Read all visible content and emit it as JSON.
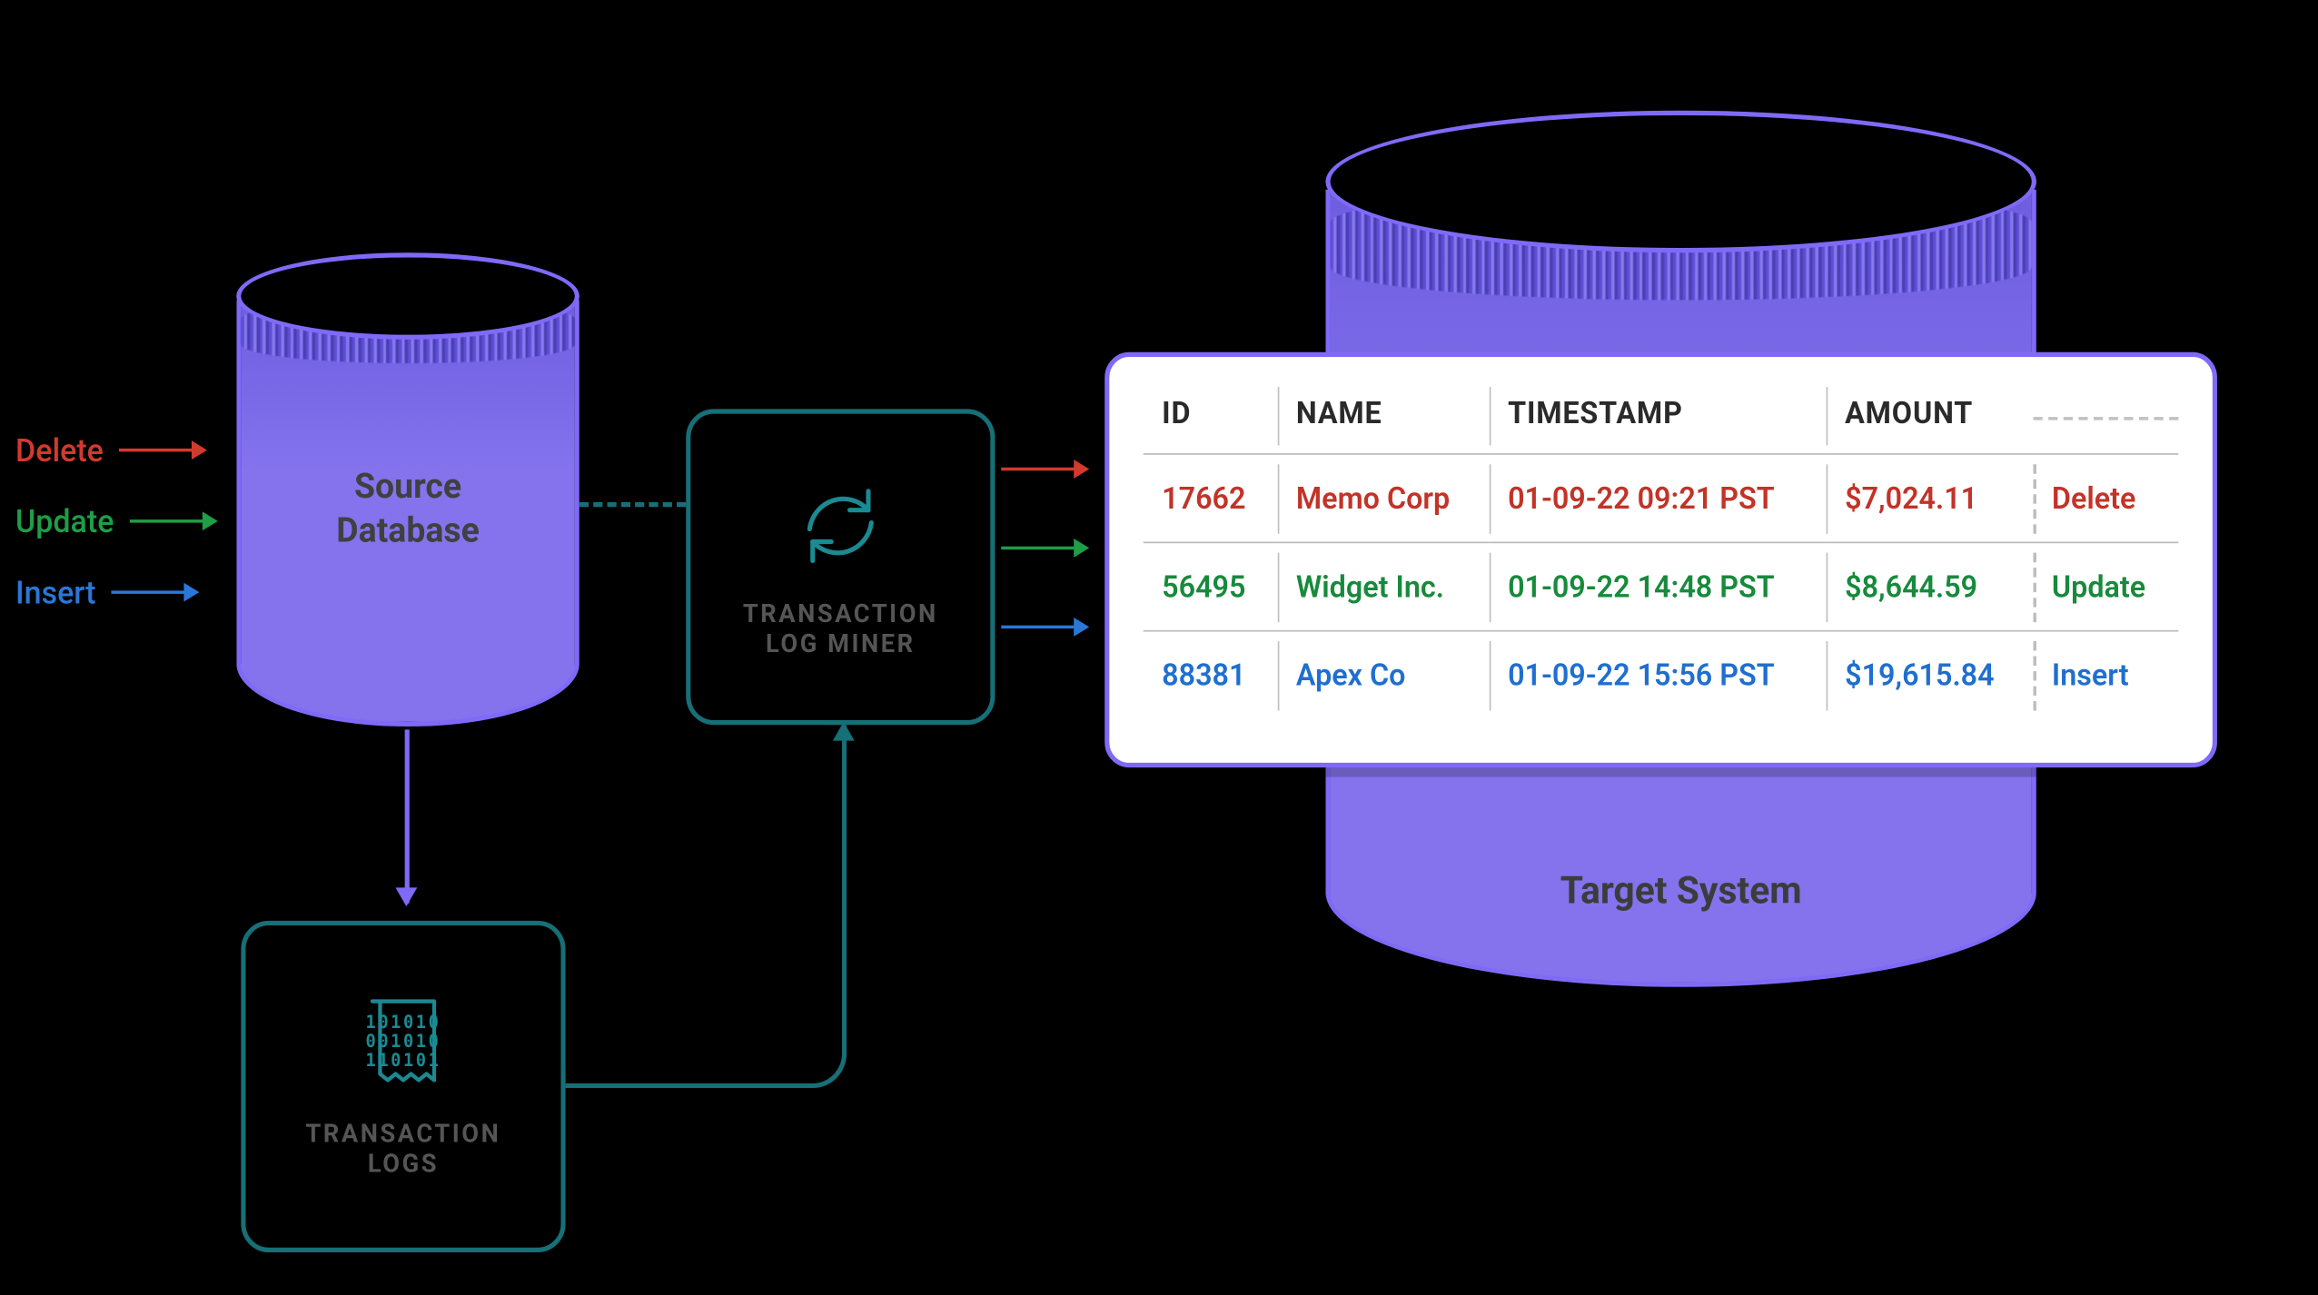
{
  "operations": {
    "delete_label": "Delete",
    "update_label": "Update",
    "insert_label": "Insert"
  },
  "source_db": {
    "label_line1": "Source",
    "label_line2": "Database"
  },
  "target_db": {
    "label": "Target System"
  },
  "miner": {
    "label_line1": "TRANSACTION",
    "label_line2": "LOG MINER"
  },
  "logs": {
    "label_line1": "TRANSACTION",
    "label_line2": "LOGS",
    "bits_line1": "101010",
    "bits_line2": "001010",
    "bits_line3": "110101"
  },
  "table": {
    "headers": {
      "id": "ID",
      "name": "NAME",
      "timestamp": "TIMESTAMP",
      "amount": "AMOUNT"
    },
    "rows": [
      {
        "id": "17662",
        "name": "Memo Corp",
        "timestamp": "01-09-22 09:21 PST",
        "amount": "$7,024.11",
        "op": "Delete"
      },
      {
        "id": "56495",
        "name": "Widget Inc.",
        "timestamp": "01-09-22 14:48 PST",
        "amount": "$8,644.59",
        "op": "Update"
      },
      {
        "id": "88381",
        "name": "Apex Co",
        "timestamp": "01-09-22 15:56 PST",
        "amount": "$19,615.84",
        "op": "Insert"
      }
    ]
  }
}
